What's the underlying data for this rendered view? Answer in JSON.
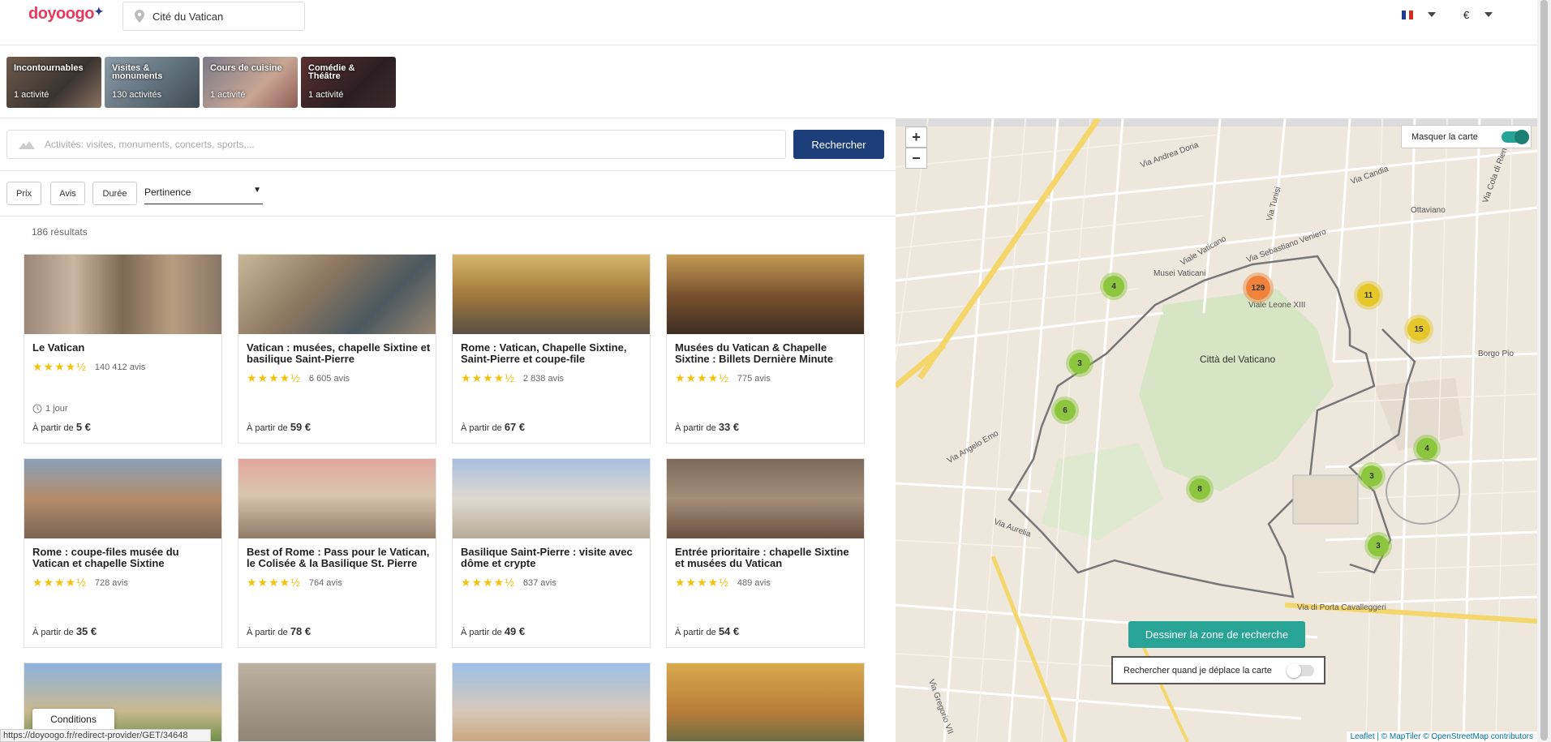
{
  "header": {
    "logo_text": "doyoogo",
    "location_value": "Cité du Vatican",
    "currency": "€"
  },
  "categories": [
    {
      "title": "Incontournables",
      "count": "1 activité"
    },
    {
      "title": "Visites & monuments",
      "count": "130 activités"
    },
    {
      "title": "Cours de cuisine",
      "count": "1 activité"
    },
    {
      "title": "Comédie & Théâtre",
      "count": "1 activité"
    }
  ],
  "search": {
    "placeholder": "Activités: visites, monuments, concerts, sports,...",
    "button_label": "Rechercher"
  },
  "filters": {
    "price": "Prix",
    "reviews": "Avis",
    "duration": "Durée",
    "sort_value": "Pertinence"
  },
  "results_count": "186 résultats",
  "price_prefix": "À partir de",
  "cards": [
    {
      "title": "Le Vatican",
      "rating": 4.5,
      "reviews": "140 412 avis",
      "duration": "1 jour",
      "price": "5 €"
    },
    {
      "title": "Vatican : musées, chapelle Sixtine et basilique Saint-Pierre",
      "rating": 4.5,
      "reviews": "6 605 avis",
      "duration": "",
      "price": "59 €"
    },
    {
      "title": "Rome : Vatican, Chapelle Sixtine, Saint-Pierre et coupe-file",
      "rating": 4.5,
      "reviews": "2 838 avis",
      "duration": "",
      "price": "67 €"
    },
    {
      "title": "Musées du Vatican & Chapelle Sixtine : Billets Dernière Minute",
      "rating": 4.5,
      "reviews": "775 avis",
      "duration": "",
      "price": "33 €"
    },
    {
      "title": "Rome : coupe-files musée du Vatican et chapelle Sixtine",
      "rating": 4.5,
      "reviews": "728 avis",
      "duration": "",
      "price": "35 €"
    },
    {
      "title": "Best of Rome : Pass pour le Vatican, le Colisée & la Basilique St. Pierre",
      "rating": 4.5,
      "reviews": "764 avis",
      "duration": "",
      "price": "78 €"
    },
    {
      "title": "Basilique Saint-Pierre : visite avec dôme et crypte",
      "rating": 4.5,
      "reviews": "637 avis",
      "duration": "",
      "price": "49 €"
    },
    {
      "title": "Entrée prioritaire : chapelle Sixtine et musées du Vatican",
      "rating": 4.5,
      "reviews": "489 avis",
      "duration": "",
      "price": "54 €"
    }
  ],
  "footer": {
    "conditions_label": "Conditions",
    "status_url": "https://doyoogo.fr/redirect-provider/GET/34648"
  },
  "map": {
    "hide_map_label": "Masquer la carte",
    "zoom_in": "+",
    "zoom_out": "−",
    "draw_button": "Dessiner la zone de recherche",
    "search_on_move_label": "Rechercher quand je déplace la carte",
    "attribution": "Leaflet | © MapTiler © OpenStreetMap contributors",
    "accent_color": "#27a496",
    "city_label": "Città del Vaticano",
    "street_labels": [
      "Via Andrea Doria",
      "Via Sebastiano Veniero",
      "Viale Vaticano",
      "Viale Leone XIII",
      "Via Aurelia",
      "Via Cola di Rienzo",
      "Borgo Pio",
      "Ottaviano",
      "Musei Vaticani",
      "Via Gregorio VII",
      "Via di Porta Cavalleggeri",
      "Via Angelo Emo",
      "Via Candia",
      "Via Tunisi"
    ],
    "clusters": [
      {
        "count": "4",
        "color": "#8cc53e"
      },
      {
        "count": "129",
        "color": "#f0823c"
      },
      {
        "count": "11",
        "color": "#e5c72a"
      },
      {
        "count": "15",
        "color": "#e5c72a"
      },
      {
        "count": "3",
        "color": "#8cc53e"
      },
      {
        "count": "6",
        "color": "#8cc53e"
      },
      {
        "count": "4",
        "color": "#8cc53e"
      },
      {
        "count": "8",
        "color": "#8cc53e"
      },
      {
        "count": "3",
        "color": "#8cc53e"
      },
      {
        "count": "3",
        "color": "#8cc53e"
      }
    ]
  }
}
